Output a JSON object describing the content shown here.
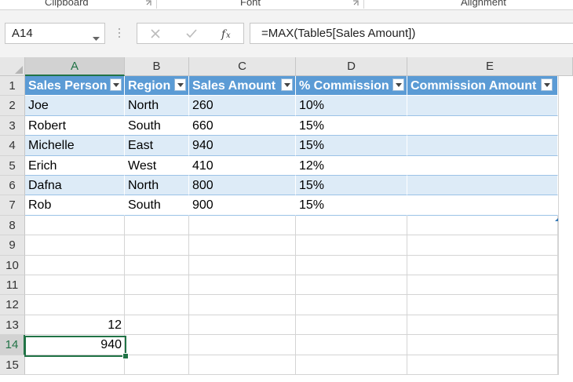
{
  "ribbon": {
    "groups": [
      "Clipboard",
      "Font",
      "Alignment"
    ]
  },
  "formula_bar": {
    "name_box": "A14",
    "cancel_icon": "close-icon",
    "enter_icon": "check-icon",
    "function_icon": "fx-icon",
    "formula": "=MAX(Table5[Sales Amount])"
  },
  "columns": [
    "A",
    "B",
    "C",
    "D",
    "E"
  ],
  "rows": [
    "1",
    "2",
    "3",
    "4",
    "5",
    "6",
    "7",
    "8",
    "9",
    "10",
    "11",
    "12",
    "13",
    "14",
    "15"
  ],
  "table": {
    "headers": [
      "Sales Person",
      "Region",
      "Sales Amount",
      "% Commission",
      "Commission Amount"
    ],
    "data": [
      [
        "Joe",
        "North",
        "260",
        "10%",
        ""
      ],
      [
        "Robert",
        "South",
        "660",
        "15%",
        ""
      ],
      [
        "Michelle",
        "East",
        "940",
        "15%",
        ""
      ],
      [
        "Erich",
        "West",
        "410",
        "12%",
        ""
      ],
      [
        "Dafna",
        "North",
        "800",
        "15%",
        ""
      ],
      [
        "Rob",
        "South",
        "900",
        "15%",
        ""
      ]
    ]
  },
  "cells": {
    "A13": "12",
    "A14": "940"
  },
  "colors": {
    "header_fill": "#5b9bd5",
    "band_fill": "#ddebf7",
    "selection": "#217346"
  }
}
